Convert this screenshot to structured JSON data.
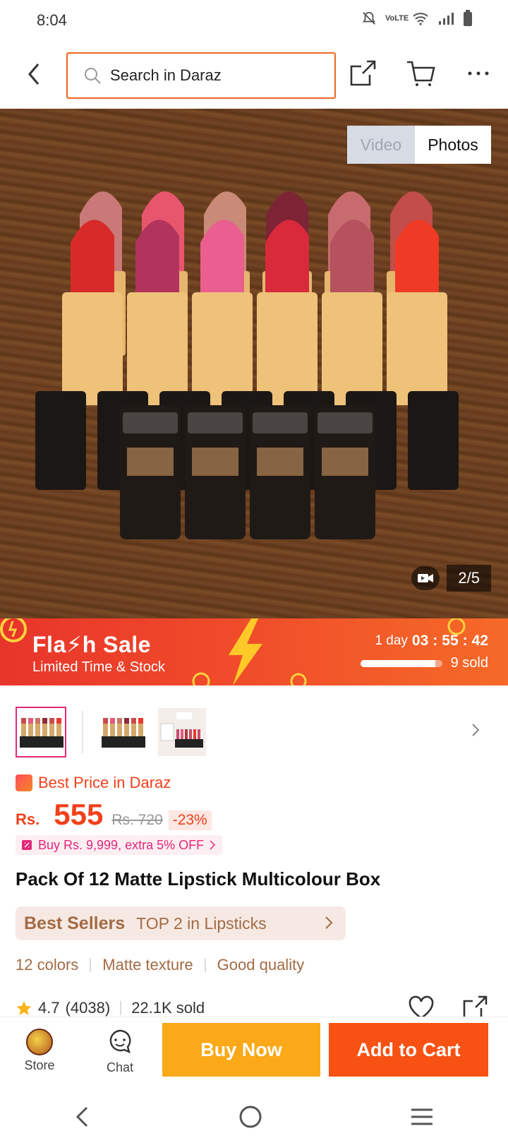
{
  "status_bar": {
    "time": "8:04",
    "network": "VoLTE"
  },
  "search": {
    "placeholder": "Search in Daraz"
  },
  "gallery": {
    "toggle_video": "Video",
    "toggle_photos": "Photos",
    "counter": "2/5"
  },
  "flash_sale": {
    "title": "Fla⚡h  Sale",
    "subtitle": "Limited Time & Stock",
    "days": "1 day",
    "hours": "03",
    "minutes": "55",
    "seconds": "42",
    "sold": "9 sold",
    "sold_progress": 0.92
  },
  "thumbnails": [
    {
      "name": "thumb-1",
      "active": true
    },
    {
      "name": "thumb-2",
      "active": false
    },
    {
      "name": "thumb-3",
      "active": false
    }
  ],
  "pricing": {
    "best_price_label": "Best Price in Daraz",
    "currency": "Rs.",
    "price": "555",
    "original_price": "Rs. 720",
    "discount": "-23%",
    "voucher": "Buy Rs. 9,999, extra 5% OFF"
  },
  "product": {
    "title": "Pack Of 12 Matte Lipstick Multicolour Box",
    "best_sellers_label": "Best Sellers",
    "best_sellers_rank": "TOP 2 in Lipsticks",
    "tags": [
      "12 colors",
      "Matte texture",
      "Good quality"
    ],
    "rating": "4.7",
    "reviews": "(4038)",
    "sold": "22.1K sold"
  },
  "bottom_bar": {
    "store": "Store",
    "chat": "Chat",
    "buy_now": "Buy Now",
    "add_to_cart": "Add to Cart"
  },
  "colors": {
    "accent": "#f1641e",
    "price": "#f1411b",
    "buy_now": "#fba919",
    "add_to_cart": "#f75214"
  }
}
